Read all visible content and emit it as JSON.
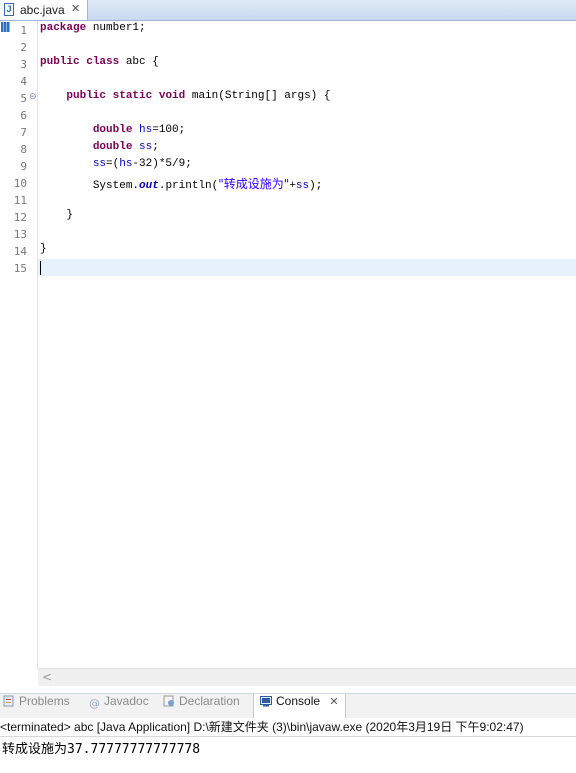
{
  "editor": {
    "tab": {
      "file_icon": "java-file-icon",
      "label": "abc.java",
      "close_glyph": "✕"
    },
    "line_numbers": [
      "1",
      "2",
      "3",
      "4",
      "5",
      "6",
      "7",
      "8",
      "9",
      "10",
      "11",
      "12",
      "13",
      "14",
      "15"
    ],
    "fold_marker": "⊖",
    "code": {
      "l1_kw": "package",
      "l1_rest": " number1;",
      "l3_kw1": "public",
      "l3_kw2": "class",
      "l3_rest": " abc {",
      "l5_kw1": "public",
      "l5_kw2": "static",
      "l5_kw3": "void",
      "l5_rest": " main(String[] args) {",
      "l7_kw": "double",
      "l7_var": "hs",
      "l7_rest": "=100;",
      "l8_kw": "double",
      "l8_var": "ss",
      "l8_rest": ";",
      "l9_var1": "ss",
      "l9_mid": "=(",
      "l9_var2": "hs",
      "l9_rest": "-32)*5/9;",
      "l10_pre": "System.",
      "l10_out": "out",
      "l10_mid": ".println(",
      "l10_str": "\"转成设施为\"",
      "l10_plus": "+",
      "l10_var": "ss",
      "l10_end": ");",
      "l12": "}",
      "l14": "}"
    },
    "scroll_left_glyph": "<"
  },
  "views": {
    "tabs": [
      {
        "label": "Problems",
        "icon": "problems-icon"
      },
      {
        "label": "Javadoc",
        "icon": "javadoc-icon"
      },
      {
        "label": "Declaration",
        "icon": "declaration-icon"
      },
      {
        "label": "Console",
        "icon": "console-icon",
        "close_glyph": "✕"
      }
    ]
  },
  "console": {
    "header": "<terminated> abc [Java Application] D:\\新建文件夹 (3)\\bin\\javaw.exe (2020年3月19日 下午9:02:47)",
    "output_label": "转成设施为",
    "output_value": "37.77777777777778"
  }
}
